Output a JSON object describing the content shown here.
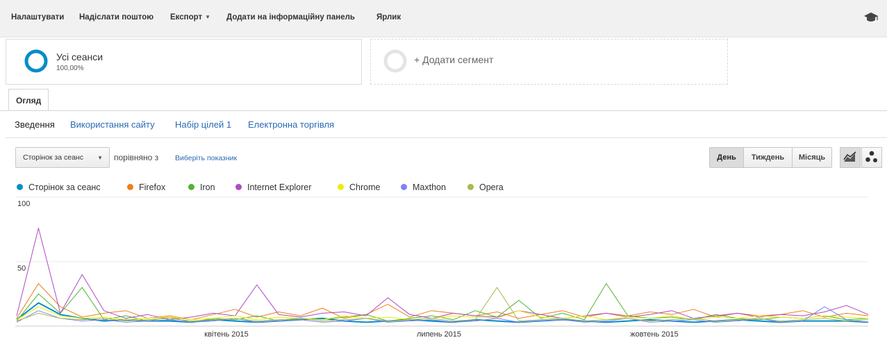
{
  "toolbar": {
    "items": [
      "Налаштувати",
      "Надіслати поштою",
      "Експорт",
      "Додати на інформаційну панель",
      "Ярлик"
    ],
    "icon": "graduation-cap-icon"
  },
  "segments": {
    "active": {
      "name": "Усі сеанси",
      "percent": "100,00%"
    },
    "add_label": "+ Додати сегмент",
    "ring_color": "#058dc7"
  },
  "tabs": [
    "Огляд"
  ],
  "subnav": [
    "Зведення",
    "Використання сайту",
    "Набір цілей 1",
    "Електронна торгівля"
  ],
  "controls": {
    "metric": "Сторінок за сеанс",
    "compare_label": "порівняно з",
    "choose_metric": "Виберіть показник",
    "period_buttons": [
      "День",
      "Тиждень",
      "Місяць"
    ],
    "active_period": "День",
    "chart_type_icons": [
      "line-chart-icon",
      "motion-chart-icon"
    ]
  },
  "chart_data": {
    "type": "line",
    "y_ticks": [
      "100",
      "50"
    ],
    "ylim": [
      0,
      100
    ],
    "x_tick_labels": [
      "квітень 2015",
      "липень 2015",
      "жовтень 2015"
    ],
    "grid": true,
    "legend_position": "top",
    "series": [
      {
        "name": "Сторінок за сеанс",
        "color": "#058dc7",
        "values": [
          5,
          18,
          9,
          6,
          4,
          5,
          4,
          4,
          3,
          5,
          4,
          3,
          4,
          5,
          6,
          4,
          3,
          4,
          5,
          4,
          3,
          5,
          4,
          3,
          4,
          5,
          4,
          3,
          4,
          5,
          4,
          3,
          4,
          5,
          4,
          3,
          4,
          4,
          4,
          3
        ]
      },
      {
        "name": "Firefox",
        "color": "#ed7e17",
        "values": [
          6,
          33,
          15,
          7,
          10,
          12,
          6,
          8,
          5,
          9,
          13,
          7,
          11,
          8,
          14,
          6,
          9,
          17,
          7,
          12,
          10,
          8,
          11,
          6,
          9,
          12,
          7,
          10,
          8,
          11,
          9,
          13,
          7,
          10,
          8,
          9,
          12,
          7,
          10,
          8
        ]
      },
      {
        "name": "Iron",
        "color": "#50b432",
        "values": [
          4,
          25,
          10,
          30,
          5,
          8,
          4,
          7,
          3,
          6,
          5,
          8,
          4,
          6,
          5,
          7,
          9,
          4,
          6,
          8,
          5,
          12,
          7,
          20,
          6,
          10,
          5,
          33,
          8,
          6,
          7,
          5,
          9,
          6,
          5,
          7,
          6,
          8,
          5,
          6
        ]
      },
      {
        "name": "Internet Explorer",
        "color": "#af49c5",
        "values": [
          8,
          76,
          10,
          40,
          12,
          6,
          9,
          5,
          7,
          10,
          8,
          32,
          9,
          7,
          10,
          11,
          8,
          22,
          9,
          6,
          10,
          8,
          7,
          12,
          9,
          6,
          8,
          10,
          7,
          9,
          12,
          6,
          8,
          10,
          7,
          9,
          8,
          11,
          16,
          9
        ]
      },
      {
        "name": "Chrome",
        "color": "#eded04",
        "values": [
          5,
          15,
          8,
          6,
          7,
          5,
          6,
          7,
          5,
          6,
          8,
          5,
          7,
          6,
          5,
          8,
          6,
          7,
          5,
          6,
          8,
          7,
          6,
          12,
          7,
          6,
          8,
          5,
          7,
          6,
          8,
          5,
          7,
          6,
          8,
          7,
          6,
          8,
          7,
          6
        ]
      },
      {
        "name": "Maxthon",
        "color": "#8080ff",
        "values": [
          3,
          12,
          6,
          4,
          5,
          3,
          4,
          5,
          3,
          4,
          6,
          3,
          4,
          5,
          3,
          4,
          6,
          3,
          4,
          5,
          3,
          4,
          6,
          3,
          4,
          5,
          3,
          4,
          6,
          3,
          4,
          5,
          3,
          4,
          6,
          3,
          4,
          15,
          5,
          3
        ]
      },
      {
        "name": "Opera",
        "color": "#a5bc4e",
        "values": [
          4,
          10,
          6,
          5,
          6,
          4,
          5,
          6,
          4,
          5,
          6,
          4,
          5,
          6,
          4,
          5,
          6,
          4,
          5,
          6,
          4,
          5,
          30,
          4,
          5,
          6,
          4,
          5,
          6,
          4,
          5,
          6,
          4,
          5,
          6,
          4,
          5,
          6,
          4,
          5
        ]
      }
    ]
  }
}
